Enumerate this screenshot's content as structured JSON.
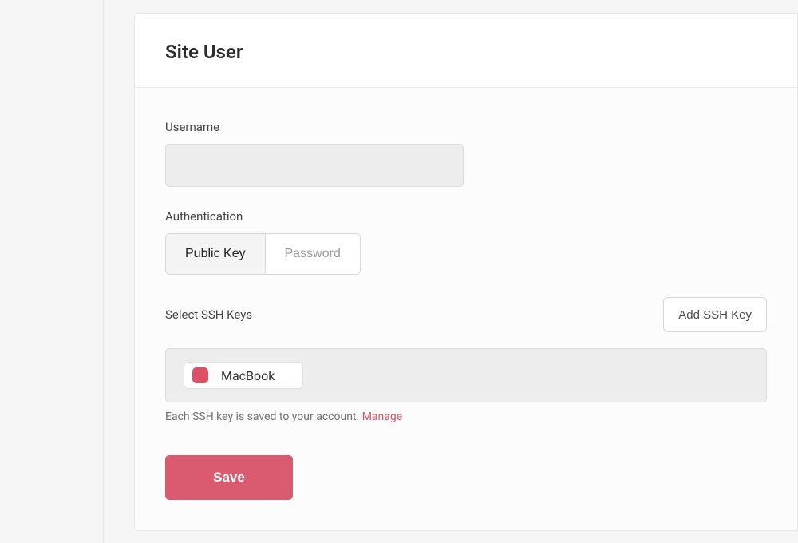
{
  "header": {
    "title": "Site User"
  },
  "form": {
    "username_label": "Username",
    "username_value": "",
    "auth_label": "Authentication",
    "auth_options": {
      "public_key": "Public Key",
      "password": "Password"
    },
    "ssh_label": "Select SSH Keys",
    "add_ssh_btn": "Add SSH Key",
    "ssh_keys": [
      {
        "name": "MacBook",
        "checked": true
      }
    ],
    "ssh_help_text": "Each SSH key is saved to your account. ",
    "ssh_manage_link": "Manage",
    "save_btn": "Save"
  },
  "colors": {
    "accent": "#dc4f66"
  }
}
